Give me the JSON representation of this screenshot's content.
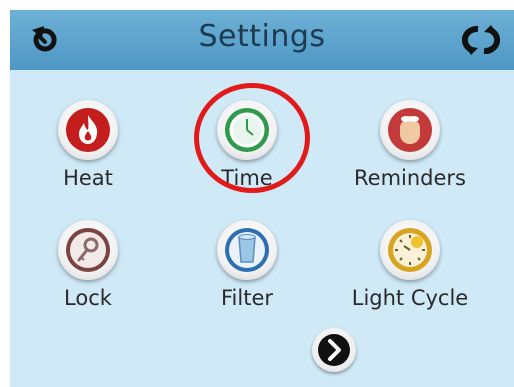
{
  "header": {
    "title": "Settings",
    "back_icon": "back-icon",
    "refresh_icon": "refresh-icon"
  },
  "menu": {
    "items": [
      {
        "label": "Heat",
        "icon": "flame-icon",
        "color": "#c41d1d"
      },
      {
        "label": "Time",
        "icon": "clock-icon",
        "color": "#2e9a4a"
      },
      {
        "label": "Reminders",
        "icon": "reminder-hand-icon",
        "color": "#c23a3a"
      },
      {
        "label": "Lock",
        "icon": "key-icon",
        "color": "#7a4440"
      },
      {
        "label": "Filter",
        "icon": "filter-cartridge-icon",
        "color": "#2d6fb0"
      },
      {
        "label": "Light Cycle",
        "icon": "light-cycle-icon",
        "color": "#d8a521"
      }
    ]
  },
  "navigation": {
    "next_icon": "chevron-right-icon"
  },
  "colors": {
    "header": "#5aa3cd",
    "background": "#cfe9f7",
    "highlight": "#e11a1a"
  }
}
